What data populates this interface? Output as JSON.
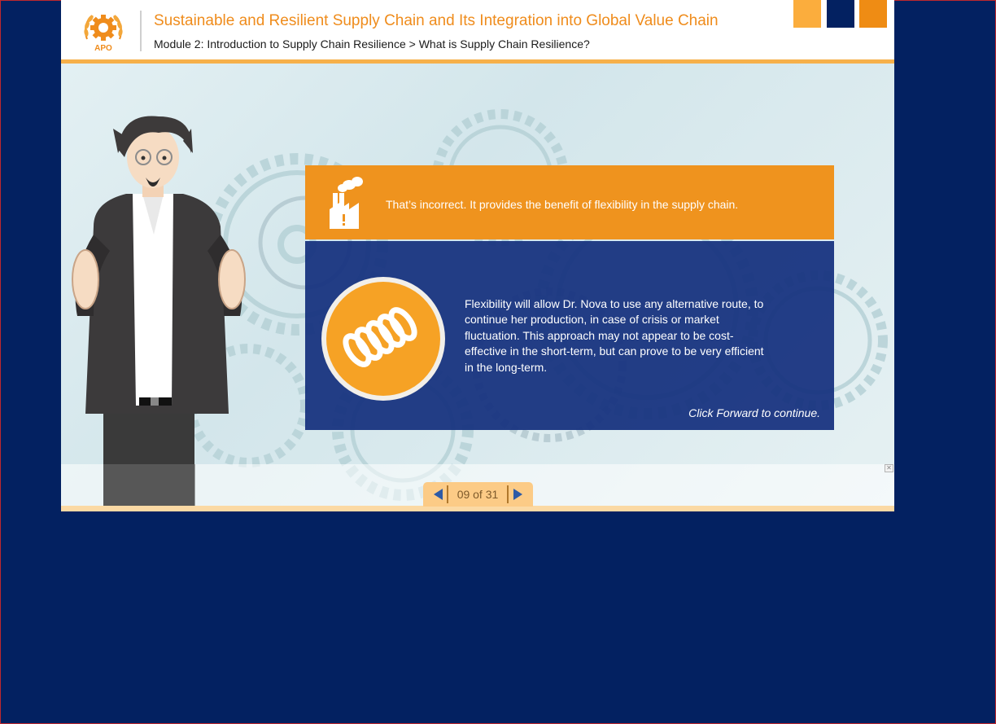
{
  "header": {
    "course_title": "Sustainable and Resilient Supply Chain and Its Integration into Global Value Chain",
    "breadcrumb": "Module 2: Introduction to Supply Chain Resilience > What is Supply Chain Resilience?",
    "logo_text": "APO"
  },
  "feedback": {
    "title": "That’s incorrect. It provides the benefit of flexibility in the supply chain.",
    "body": "Flexibility will allow Dr. Nova to use any alternative route, to continue her production, in case of crisis or market fluctuation. This approach may not appear to be cost-effective in the short-term, but can prove to be very efficient in the long-term.",
    "continue_hint": "Click Forward to continue."
  },
  "navigation": {
    "page_counter": "09 of 31",
    "current_page": 9,
    "total_pages": 31
  },
  "colors": {
    "page_background": "#032161",
    "accent_orange": "#ef931e",
    "accent_light_orange": "#fbad3d",
    "panel_blue": "#16327e",
    "title_orange": "#ef8c1c"
  },
  "icons": {
    "expand": "double-chevron-right-icon",
    "factory": "factory-warning-icon",
    "flexibility": "spring-icon",
    "prev": "triangle-left-icon",
    "next": "triangle-right-icon",
    "close": "close-icon"
  }
}
